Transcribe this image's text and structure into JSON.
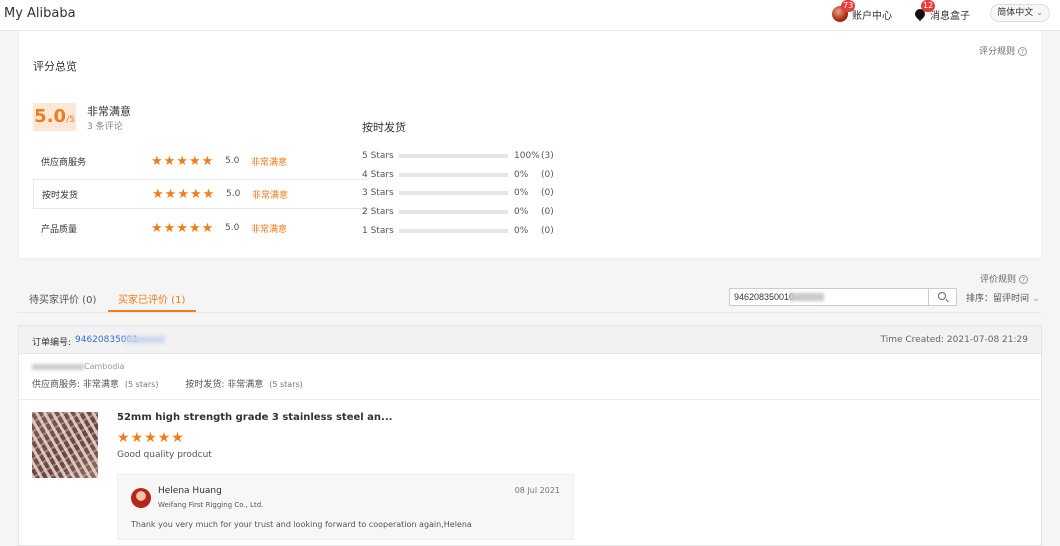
{
  "header": {
    "brand": "My Alibaba",
    "account_label": "账户中心",
    "account_badge": "73",
    "messages_label": "消息盒子",
    "messages_badge": "12",
    "language": "简体中文"
  },
  "summary": {
    "title": "评分总览",
    "rules_link": "评分规则",
    "help_glyph": "?",
    "score": "5.0",
    "score_suffix": "/5",
    "score_label": "非常满意",
    "review_count": "3 条评论",
    "metrics": [
      {
        "name": "供应商服务",
        "score": "5.0",
        "rating_text": "非常满意",
        "stars": 5
      },
      {
        "name": "按时发货",
        "score": "5.0",
        "rating_text": "非常满意",
        "stars": 5
      },
      {
        "name": "产品质量",
        "score": "5.0",
        "rating_text": "非常满意",
        "stars": 5
      }
    ],
    "distribution_title": "按时发货",
    "distribution": [
      {
        "label": "5 Stars",
        "percent_text": "100%",
        "count": "(3)",
        "fraction": 1.0
      },
      {
        "label": "4 Stars",
        "percent_text": "0%",
        "count": "(0)",
        "fraction": 0
      },
      {
        "label": "3 Stars",
        "percent_text": "0%",
        "count": "(0)",
        "fraction": 0
      },
      {
        "label": "2 Stars",
        "percent_text": "0%",
        "count": "(0)",
        "fraction": 0
      },
      {
        "label": "1 Stars",
        "percent_text": "0%",
        "count": "(0)",
        "fraction": 0
      }
    ]
  },
  "tabs": {
    "rules_link": "评价规则",
    "items": [
      {
        "label": "待买家评价 (0)"
      },
      {
        "label": "买家已评价 (1)"
      }
    ],
    "search_value": "946208350010",
    "sort_label": "排序：留评时间",
    "sort_chevron": "⌄"
  },
  "order": {
    "order_label": "订单编号:",
    "order_number": "94620835001",
    "time_created": "Time Created: 2021-07-08 21:29",
    "buyer_country": "Cambodia",
    "supplier_service_label": "供应商服务: 非常满意",
    "supplier_service_stars": "(5 stars)",
    "ontime_label": "按时发货: 非常满意",
    "ontime_stars": "(5 stars)",
    "product_title": "52mm high strength grade 3 stainless steel an...",
    "review_stars": 5,
    "review_text": "Good quality prodcut",
    "reply": {
      "name": "Helena Huang",
      "company": "Weifang First Rigging Co., Ltd.",
      "date": "08 Jul 2021",
      "text": "Thank you very much for your trust and looking forward to  cooperation again,Helena"
    }
  },
  "colors": {
    "accent": "#f07c1c",
    "link": "#2a73c7",
    "badge": "#e43d3d"
  }
}
